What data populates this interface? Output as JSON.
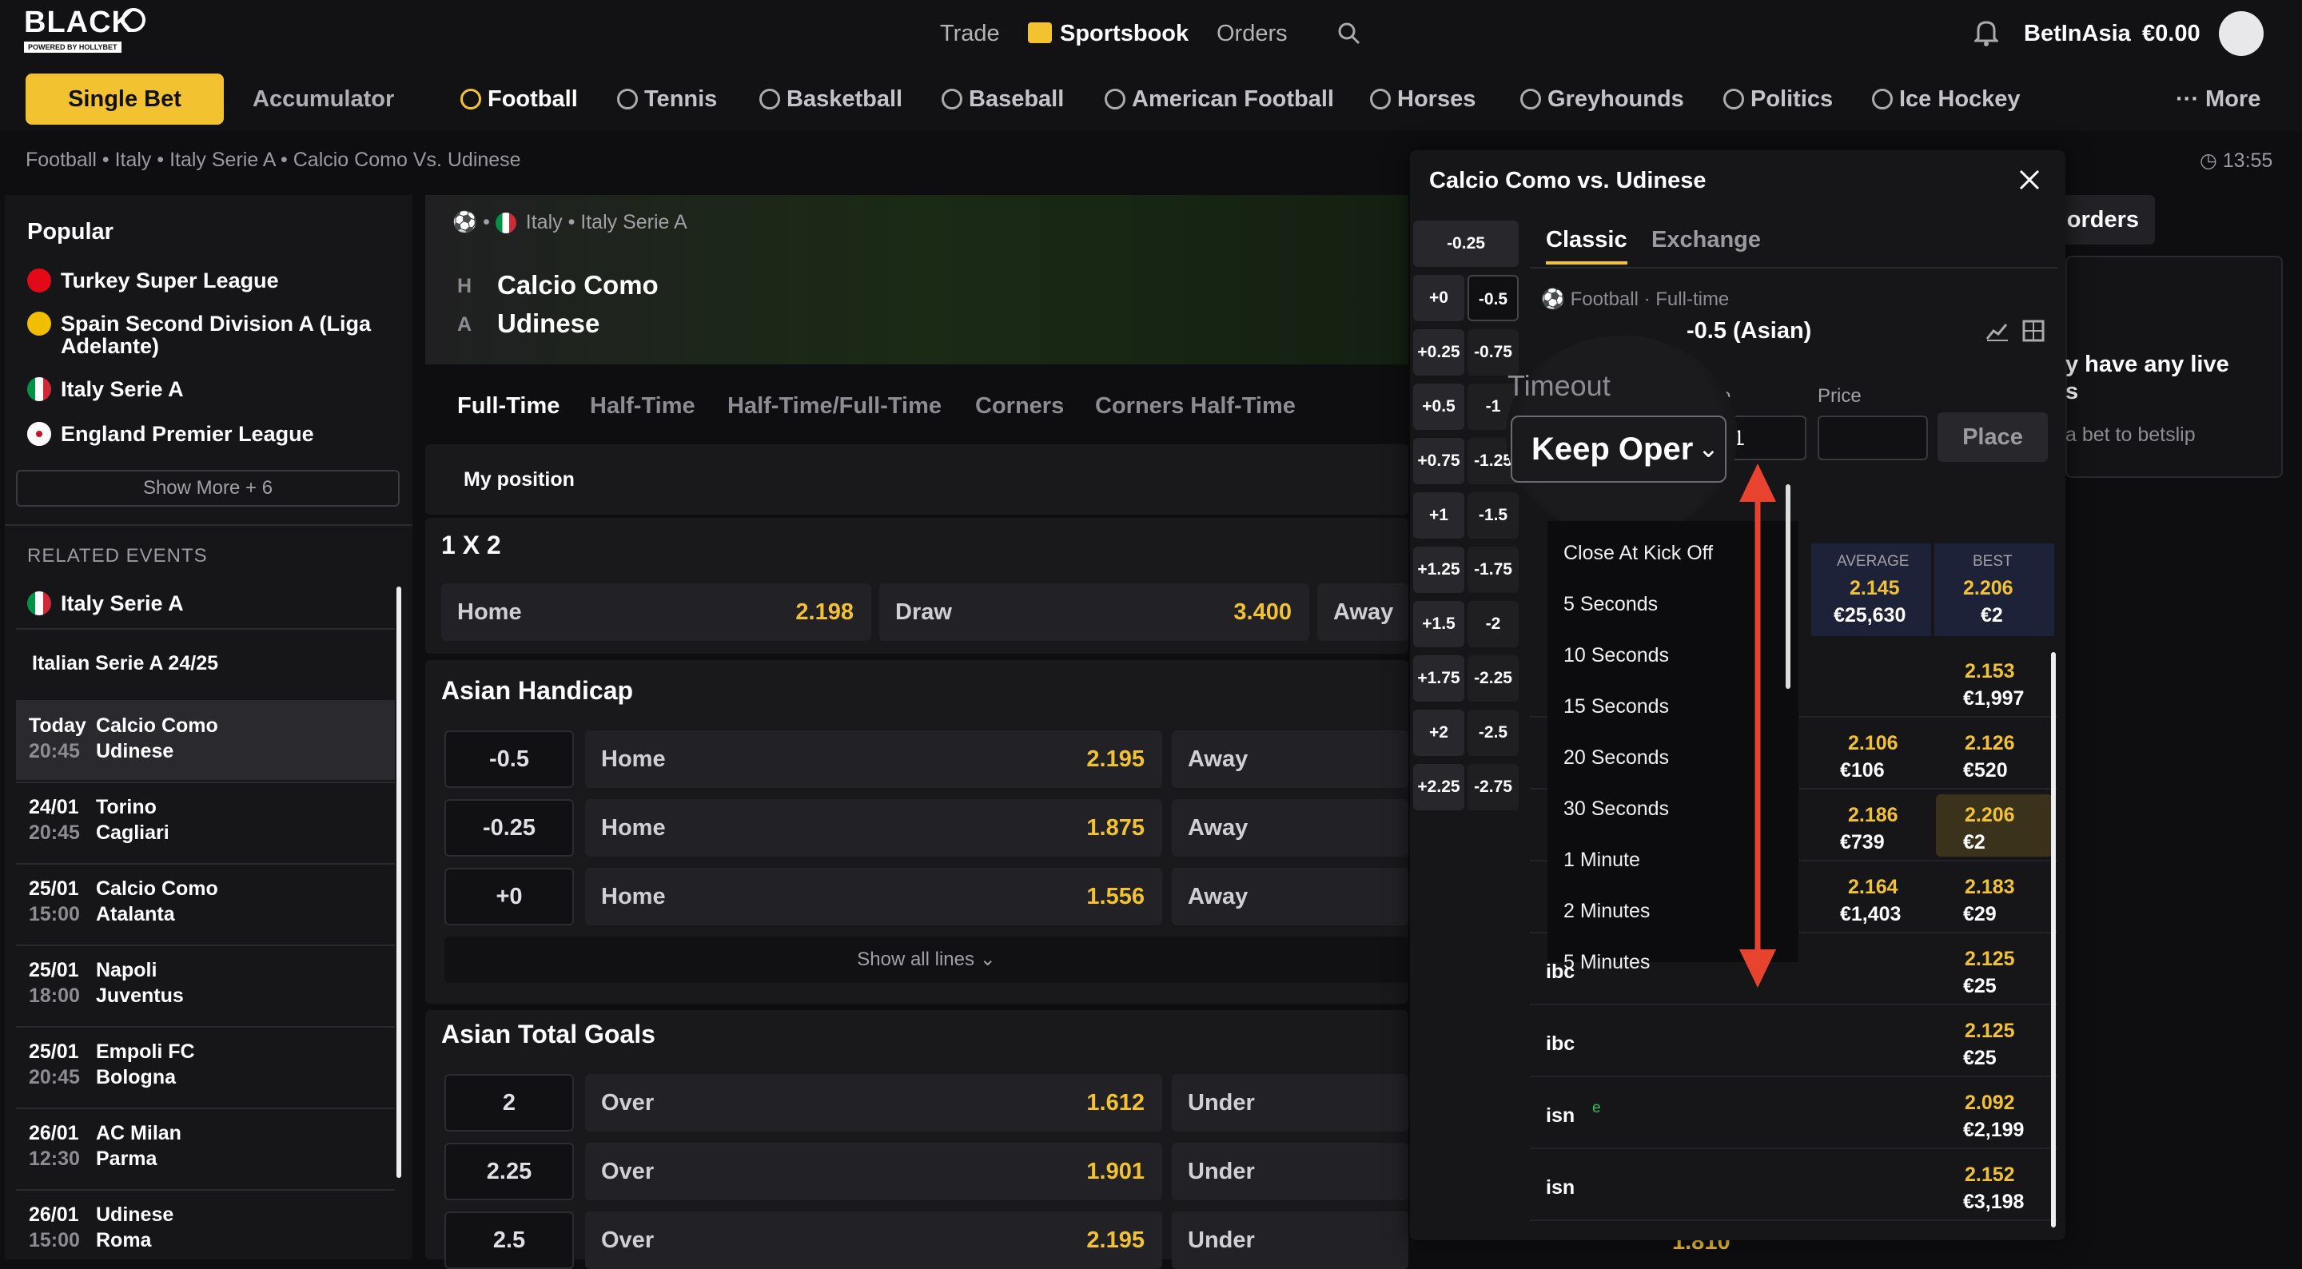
{
  "brand": {
    "name": "BLACK",
    "tagline": "POWERED BY HOLLYBET"
  },
  "topnav": {
    "trade": "Trade",
    "sportsbook": "Sportsbook",
    "orders": "Orders"
  },
  "account": {
    "user": "BetInAsia",
    "balance": "€0.00"
  },
  "bet_mode": {
    "single": "Single Bet",
    "accumulator": "Accumulator"
  },
  "sports": [
    "Football",
    "Tennis",
    "Basketball",
    "Baseball",
    "American Football",
    "Horses",
    "Greyhounds",
    "Politics",
    "Ice Hockey"
  ],
  "more_label": "More",
  "breadcrumb": "Football • Italy • Italy Serie A • Calcio Como Vs. Udinese",
  "clock": "13:55",
  "popular": {
    "title": "Popular",
    "items": [
      "Turkey Super League",
      "Spain Second Division A (Liga",
      "Adelante)",
      "Italy Serie A",
      "England Premier League"
    ],
    "show_more": "Show More + 6"
  },
  "related": {
    "title": "RELATED EVENTS",
    "league": "Italy Serie A",
    "season": "Italian Serie A 24/25",
    "events": [
      {
        "date": "Today",
        "time": "20:45",
        "home": "Calcio Como",
        "away": "Udinese"
      },
      {
        "date": "24/01",
        "time": "20:45",
        "home": "Torino",
        "away": "Cagliari"
      },
      {
        "date": "25/01",
        "time": "15:00",
        "home": "Calcio Como",
        "away": "Atalanta"
      },
      {
        "date": "25/01",
        "time": "18:00",
        "home": "Napoli",
        "away": "Juventus"
      },
      {
        "date": "25/01",
        "time": "20:45",
        "home": "Empoli FC",
        "away": "Bologna"
      },
      {
        "date": "26/01",
        "time": "12:30",
        "home": "AC Milan",
        "away": "Parma"
      },
      {
        "date": "26/01",
        "time": "15:00",
        "home": "Udinese",
        "away": "Roma"
      }
    ]
  },
  "match": {
    "league_path": "Italy • Italy Serie A",
    "home_tag": "H",
    "away_tag": "A",
    "home": "Calcio Como",
    "away": "Udinese"
  },
  "market_tabs": [
    "Full-Time",
    "Half-Time",
    "Half-Time/Full-Time",
    "Corners",
    "Corners Half-Time"
  ],
  "my_position": "My position",
  "onextwo": {
    "title": "1 X 2",
    "home": "Home",
    "home_odds": "2.198",
    "draw": "Draw",
    "draw_odds": "3.400",
    "away": "Away"
  },
  "asian_handicap": {
    "title": "Asian Handicap",
    "rows": [
      {
        "line": "-0.5",
        "label": "Home",
        "odds": "2.195",
        "away": "Away"
      },
      {
        "line": "-0.25",
        "label": "Home",
        "odds": "1.875",
        "away": "Away"
      },
      {
        "line": "+0",
        "label": "Home",
        "odds": "1.556",
        "away": "Away"
      }
    ],
    "show_all": "Show all lines"
  },
  "asian_total": {
    "title": "Asian Total Goals",
    "rows": [
      {
        "line": "2",
        "label": "Over",
        "odds": "1.612",
        "away": "Under"
      },
      {
        "line": "2.25",
        "label": "Over",
        "odds": "1.901",
        "away": "Under"
      },
      {
        "line": "2.5",
        "label": "Over",
        "odds": "2.195",
        "away": "Under",
        "away_odds": "1.810"
      }
    ]
  },
  "popup": {
    "title": "Calcio Como vs. Udinese",
    "tabs": {
      "classic": "Classic",
      "exchange": "Exchange"
    },
    "meta": "Football · Full-time",
    "market": "-0.5 (Asian)",
    "stake_label": "ke",
    "price_label": "Price",
    "stake_value": "1",
    "place": "Place",
    "timeout_label": "Timeout",
    "timeout_value": "Keep Oper",
    "handicaps": [
      [
        "-0.25",
        ""
      ],
      [
        "+0",
        "-0.5"
      ],
      [
        "+0.25",
        "-0.75"
      ],
      [
        "+0.5",
        "-1"
      ],
      [
        "+0.75",
        "-1.25"
      ],
      [
        "+1",
        "-1.5"
      ],
      [
        "+1.25",
        "-1.75"
      ],
      [
        "+1.5",
        "-2"
      ],
      [
        "+1.75",
        "-2.25"
      ],
      [
        "+2",
        "-2.5"
      ],
      [
        "+2.25",
        "-2.75"
      ]
    ],
    "timeout_options": [
      "Close At Kick Off",
      "5 Seconds",
      "10 Seconds",
      "15 Seconds",
      "20 Seconds",
      "30 Seconds",
      "1 Minute",
      "2 Minutes",
      "5 Minutes"
    ],
    "avg_label": "AVERAGE",
    "best_label": "BEST",
    "avg_odds": "2.145",
    "avg_amount": "€25,630",
    "best_odds": "2.206",
    "best_amount": "€2",
    "books": [
      {
        "name": "",
        "avg": "",
        "avg_amt": "",
        "best": "2.153",
        "best_amt": "€1,997"
      },
      {
        "name": "",
        "avg": "2.106",
        "avg_amt": "€106",
        "best": "2.126",
        "best_amt": "€520"
      },
      {
        "name": "",
        "avg": "2.186",
        "avg_amt": "€739",
        "best": "2.206",
        "best_amt": "€2"
      },
      {
        "name": "",
        "avg": "2.164",
        "avg_amt": "€1,403",
        "best": "2.183",
        "best_amt": "€29"
      },
      {
        "name": "ibc",
        "avg": "",
        "avg_amt": "",
        "best": "2.125",
        "best_amt": "€25"
      },
      {
        "name": "ibc",
        "avg": "",
        "avg_amt": "",
        "best": "2.125",
        "best_amt": "€25"
      },
      {
        "name": "isn",
        "avg": "",
        "avg_amt": "",
        "best": "2.092",
        "best_amt": "€2,199"
      },
      {
        "name": "isn",
        "avg": "",
        "avg_amt": "",
        "best": "2.152",
        "best_amt": "€3,198"
      }
    ]
  },
  "right": {
    "tab": "orders",
    "msg1": "y have any live",
    "msg2": "s",
    "msg3": "a bet to betslip"
  },
  "colors": {
    "accent": "#f2c230",
    "arrow": "#e8432f",
    "bg": "#0e0e10"
  }
}
